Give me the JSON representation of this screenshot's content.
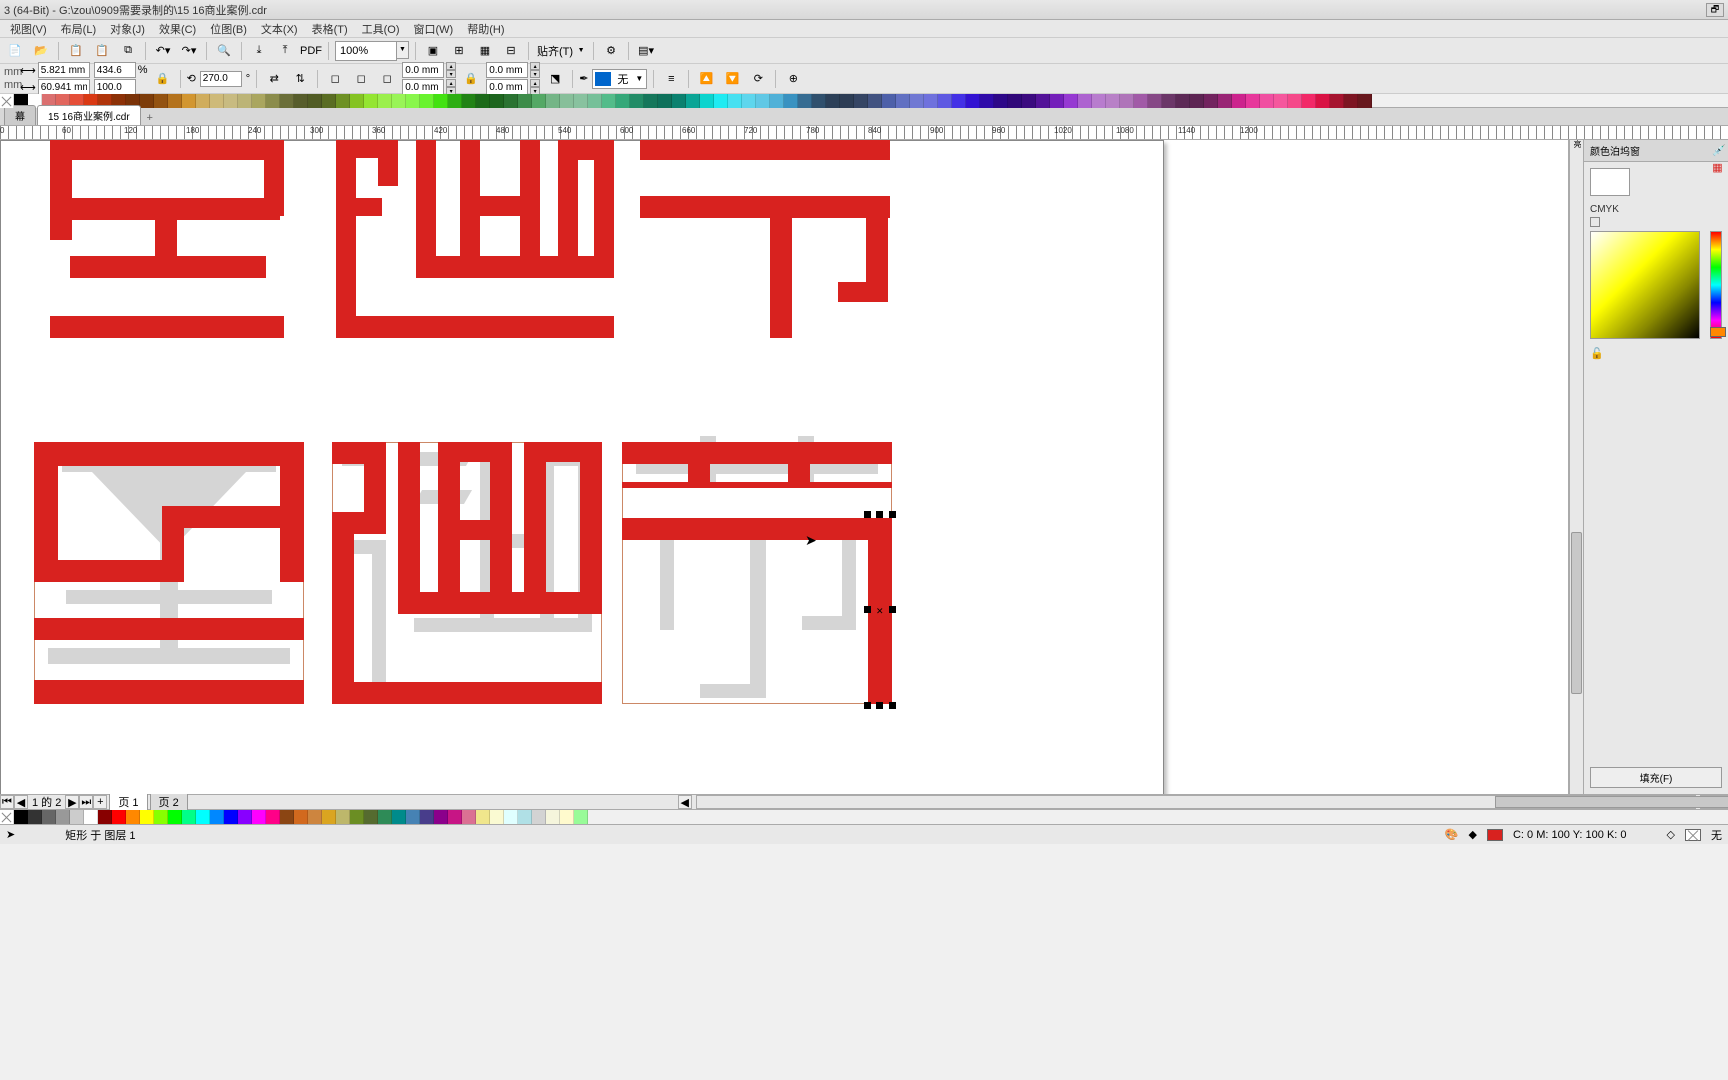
{
  "titlebar": {
    "text": "3 (64-Bit) - G:\\zou\\0909需要录制的\\15 16商业案例.cdr"
  },
  "menu": {
    "items": [
      "视图(V)",
      "布局(L)",
      "对象(J)",
      "效果(C)",
      "位图(B)",
      "文本(X)",
      "表格(T)",
      "工具(O)",
      "窗口(W)",
      "帮助(H)"
    ]
  },
  "toolbar": {
    "zoom": "100%",
    "snap_label": "贴齐(T)"
  },
  "props": {
    "x": "5.821 mm",
    "y": "60.941 mm",
    "w": "434.6",
    "h": "100.0",
    "pct": "%",
    "rotation": "270.0",
    "outline1": "0.0 mm",
    "outline2": "0.0 mm",
    "outline3": "0.0 mm",
    "outline4": "0.0 mm",
    "fill_label": "无"
  },
  "tabs": {
    "t1": "幕",
    "t2": "15 16商业案例.cdr"
  },
  "ruler_marks": [
    0,
    60,
    120,
    180,
    240,
    300,
    360,
    420,
    480,
    540,
    600,
    660,
    720,
    780,
    840,
    900,
    960,
    1020,
    1080,
    1140
  ],
  "ruler_values": [
    "",
    "60",
    "",
    "180",
    "240",
    "300",
    "360",
    "420",
    "480",
    "540",
    "600",
    "660",
    "720",
    "780",
    "840",
    "900",
    "960",
    "1020",
    "1080",
    "1140"
  ],
  "right_panel": {
    "title": "颜色泊坞窗",
    "mode": "CMYK",
    "fill_btn": "填充(F)"
  },
  "nav": {
    "pages": "1 的 2",
    "page1": "页 1",
    "page2": "页 2"
  },
  "status": {
    "obj": "矩形 于 图层 1",
    "color": "C: 0 M: 100 Y: 100 K: 0",
    "outline": "无"
  },
  "ruler_unit": "mm",
  "side_label": "亮"
}
